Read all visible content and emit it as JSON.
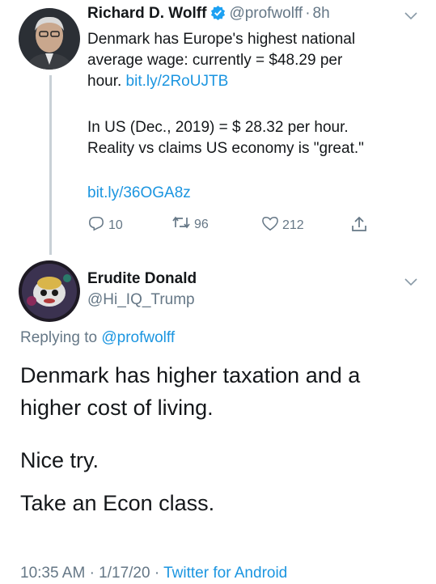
{
  "tweet1": {
    "author_name": "Richard D. Wolff",
    "author_handle": "@profwolff",
    "separator": "·",
    "time": "8h",
    "line1": "Denmark has Europe's highest national",
    "line2": "average wage: currently = $48.29 per",
    "line3_text": "hour. ",
    "line3_link": "bit.ly/2RoUJTB",
    "para2_line1": "In US (Dec., 2019) = $ 28.32 per hour.",
    "para2_line2": "Reality vs claims US economy is \"great.\"",
    "link2": "bit.ly/36OGA8z",
    "replies": "10",
    "retweets": "96",
    "likes": "212"
  },
  "tweet2": {
    "author_name": "Erudite Donald",
    "author_handle": "@Hi_IQ_Trump",
    "replying_label": "Replying to",
    "replying_handle": "@profwolff",
    "body_line1": "Denmark has higher taxation and a",
    "body_line2": "higher cost of living.",
    "body_line3": "Nice try.",
    "body_line4": "Take an Econ class.",
    "footer_time": "10:35 AM",
    "footer_sep1": "·",
    "footer_date": "1/17/20",
    "footer_sep2": "·",
    "footer_source": "Twitter for Android"
  },
  "icons": {
    "verified": "verified-badge-icon",
    "chevron": "chevron-down-icon",
    "reply": "reply-icon",
    "retweet": "retweet-icon",
    "like": "heart-icon",
    "share": "share-icon"
  },
  "colors": {
    "link": "#1b95e0",
    "muted": "#657786",
    "text": "#14171a",
    "thread_line": "#c8d0d6"
  }
}
